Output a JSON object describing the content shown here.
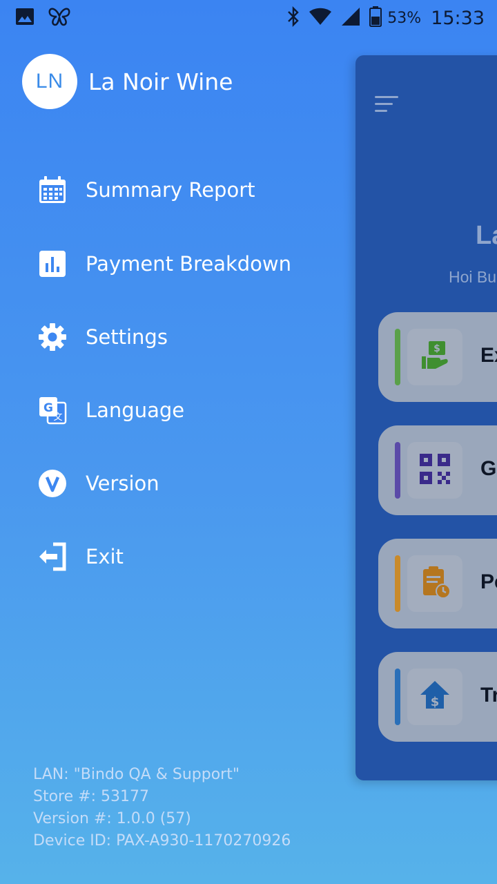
{
  "status_bar": {
    "battery_percent": "53%",
    "time": "15:33",
    "icons": [
      "image-notification-icon",
      "butterfly-app-icon",
      "bluetooth-icon",
      "wifi-icon",
      "cellular-signal-icon",
      "battery-icon"
    ]
  },
  "drawer": {
    "avatar_initials": "LN",
    "store_name": "La Noir Wine",
    "menu": [
      {
        "label": "Summary Report",
        "icon": "calendar-icon"
      },
      {
        "label": "Payment Breakdown",
        "icon": "bar-chart-icon"
      },
      {
        "label": "Settings",
        "icon": "gear-icon"
      },
      {
        "label": "Language",
        "icon": "translate-icon"
      },
      {
        "label": "Version",
        "icon": "version-icon"
      },
      {
        "label": "Exit",
        "icon": "exit-icon"
      }
    ],
    "footer": {
      "lan": "LAN: \"Bindo QA & Support\"",
      "store": "Store #: 53177",
      "version": "Version #: 1.0.0 (57)",
      "device": "Device ID: PAX-A930-1170270926"
    }
  },
  "background_screen": {
    "title_partial": "La",
    "subtitle_partial": "Hoi Bu",
    "cards": [
      {
        "label_partial": "Ex",
        "accent": "#5aa04a",
        "icon": "cash-payment-icon"
      },
      {
        "label_partial": "Ge",
        "accent": "#5a4aa8",
        "icon": "qr-code-icon"
      },
      {
        "label_partial": "Pe",
        "accent": "#c98a2a",
        "icon": "pending-clipboard-icon"
      },
      {
        "label_partial": "Tr",
        "accent": "#2a6fb8",
        "icon": "transfer-home-icon"
      }
    ]
  },
  "colors": {
    "gradient_top": "#3b84f2",
    "gradient_bottom": "#56b2ea",
    "panel": "#2353a6",
    "avatar_text": "#3a8be8"
  }
}
